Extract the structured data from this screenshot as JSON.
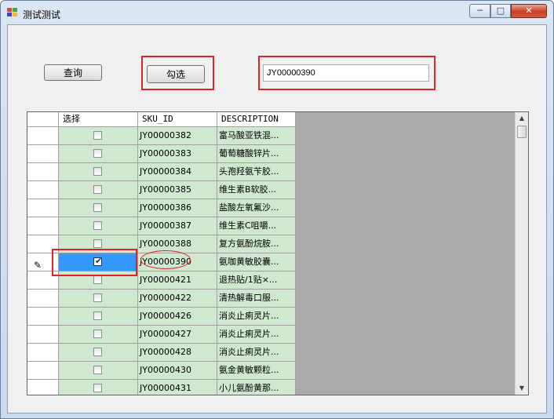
{
  "window": {
    "title": "测试测试",
    "controls": {
      "minimize": "─",
      "maximize": "□",
      "close": "✕"
    }
  },
  "toolbar": {
    "query_label": "查询",
    "check_label": "勾选",
    "sku_input_value": "JY00000390"
  },
  "grid": {
    "columns": [
      "选择",
      "SKU_ID",
      "DESCRIPTION"
    ],
    "rows": [
      {
        "checked": false,
        "sku": "JY00000382",
        "desc": "富马酸亚铁混..."
      },
      {
        "checked": false,
        "sku": "JY00000383",
        "desc": "葡萄糖酸锌片..."
      },
      {
        "checked": false,
        "sku": "JY00000384",
        "desc": "头孢羟氨苄胶..."
      },
      {
        "checked": false,
        "sku": "JY00000385",
        "desc": "维生素B软胶..."
      },
      {
        "checked": false,
        "sku": "JY00000386",
        "desc": "盐酸左氧氟沙..."
      },
      {
        "checked": false,
        "sku": "JY00000387",
        "desc": "维生素C咀嚼..."
      },
      {
        "checked": false,
        "sku": "JY00000388",
        "desc": "复方氨酚烷胺..."
      },
      {
        "checked": true,
        "sku": "JY00000390",
        "desc": "氨咖黄敏胶囊...",
        "editing": true,
        "selected": true
      },
      {
        "checked": false,
        "sku": "JY00000421",
        "desc": "退热贴/1贴×..."
      },
      {
        "checked": false,
        "sku": "JY00000422",
        "desc": "清热解毒口服..."
      },
      {
        "checked": false,
        "sku": "JY00000426",
        "desc": "消炎止痢灵片..."
      },
      {
        "checked": false,
        "sku": "JY00000427",
        "desc": "消炎止痢灵片..."
      },
      {
        "checked": false,
        "sku": "JY00000428",
        "desc": "消炎止痢灵片..."
      },
      {
        "checked": false,
        "sku": "JY00000430",
        "desc": "氨金黄敏颗粒..."
      },
      {
        "checked": false,
        "sku": "JY00000431",
        "desc": "小儿氨酚黄那..."
      }
    ]
  },
  "colors": {
    "row_bg": "#cfe8cf",
    "selection": "#3399ff",
    "annotation_red": "#e0222a"
  }
}
